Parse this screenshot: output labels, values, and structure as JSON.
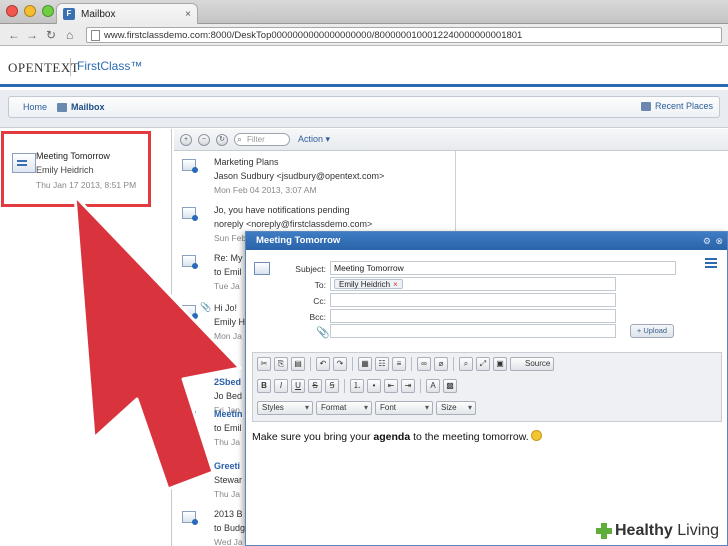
{
  "browser": {
    "tab_title": "Mailbox",
    "tab_close": "×",
    "url": "www.firstclassdemo.com:8000/DeskTop0000000000000000000/8000000100012240000000001801"
  },
  "app": {
    "brand": "OPENTEXT",
    "product": "FirstClass™"
  },
  "nav": {
    "home": "Home",
    "current": "Mailbox",
    "recent": "Recent Places"
  },
  "folder_item": {
    "subject": "Meeting Tomorrow",
    "from": "Emily Heidrich",
    "date": "Thu Jan 17 2013, 8:51 PM"
  },
  "list_toolbar": {
    "filter_placeholder": "Filter",
    "action": "Action ▾"
  },
  "messages": [
    {
      "line1": "Marketing Plans",
      "line2": "Jason Sudbury <jsudbury@opentext.com>",
      "line3": "Mon Feb 04 2013, 3:07 AM"
    },
    {
      "line1": "Jo, you have notifications pending",
      "line2": "noreply <noreply@firstclassdemo.com>",
      "line3": "Sun Feb"
    },
    {
      "line1": "Re: My",
      "line2": "to Emil",
      "line3": "Tue Ja"
    },
    {
      "line1": "Hi Jo!",
      "line2": "Emily H",
      "line3": "Mon Ja"
    },
    {
      "line1": "2Sbed",
      "line2": "Jo Bed",
      "line3": "Fri Jan"
    },
    {
      "line1": "Meetin",
      "line2": "to Emil",
      "line3": "Thu Ja"
    },
    {
      "line1": "Greeti",
      "line2": "Stewar",
      "line3": "Thu Ja"
    },
    {
      "line1": "2013 B",
      "line2": "to Budg",
      "line3": "Wed Ja"
    }
  ],
  "compose": {
    "title": "Meeting Tomorrow",
    "labels": {
      "subject": "Subject:",
      "to": "To:",
      "cc": "Cc:",
      "bcc": "Bcc:"
    },
    "subject_value": "Meeting Tomorrow",
    "to_recipient": "Emily Heidrich",
    "chip_remove": "×",
    "upload_label": "+ Upload",
    "toolbar": {
      "source": "Source",
      "bold": "B",
      "italic": "I",
      "underline": "U",
      "strike": "S",
      "styles": "Styles",
      "format": "Format",
      "font": "Font",
      "size": "Size"
    },
    "body_before": "Make sure you bring your ",
    "body_bold": "agenda",
    "body_after": " to the meeting tomorrow."
  },
  "watermark": {
    "brand_bold": "Healthy",
    "brand_rest": " Living"
  },
  "colors": {
    "accent": "#2d6bb0",
    "annotation_red": "#e13b3f",
    "arrow_red": "#d9343d"
  }
}
